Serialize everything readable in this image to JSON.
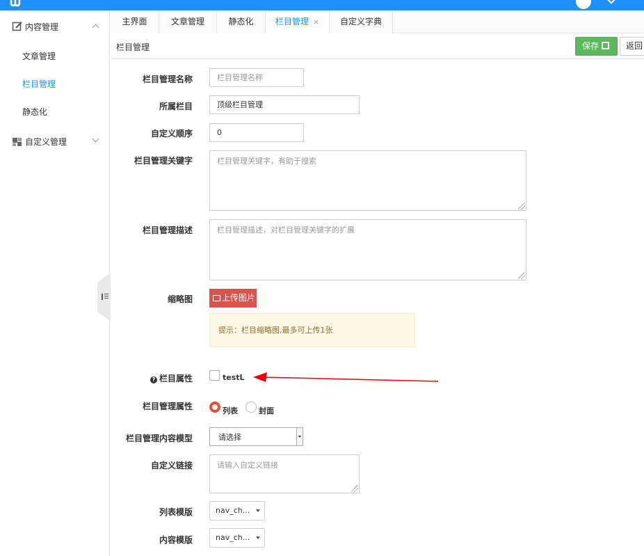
{
  "sidebar": {
    "groups": [
      {
        "label": "内容管理",
        "icon": "edit-icon"
      },
      {
        "label": "自定义管理",
        "icon": "grid-icon"
      }
    ],
    "items": [
      {
        "label": "文章管理"
      },
      {
        "label": "栏目管理"
      },
      {
        "label": "静态化"
      }
    ]
  },
  "tabs": [
    {
      "label": "主界面"
    },
    {
      "label": "文章管理"
    },
    {
      "label": "静态化"
    },
    {
      "label": "栏目管理",
      "close": "×"
    },
    {
      "label": "自定义字典"
    }
  ],
  "toolbar": {
    "title": "栏目管理",
    "save_label": "保存",
    "back_label": "返回"
  },
  "form": {
    "name": {
      "label": "栏目管理名称",
      "placeholder": "栏目管理名称"
    },
    "parent": {
      "label": "所属栏目",
      "value": "顶级栏目管理"
    },
    "order": {
      "label": "自定义顺序",
      "value": "0"
    },
    "keywords": {
      "label": "栏目管理关键字",
      "placeholder": "栏目管理关键字，有助于搜索"
    },
    "description": {
      "label": "栏目管理描述",
      "placeholder": "栏目管理描述，对栏目管理关键字的扩展"
    },
    "thumbnail": {
      "label": "缩略图",
      "button": "上传图片",
      "hint": "提示：栏目缩略图,最多可上传1张"
    },
    "attribute": {
      "label": "栏目属性",
      "option": "testL"
    },
    "type": {
      "label": "栏目管理属性",
      "options": [
        "列表",
        "封面"
      ],
      "selected": "列表"
    },
    "model": {
      "label": "栏目管理内容模型",
      "value": "请选择"
    },
    "link": {
      "label": "自定义链接",
      "placeholder": "请输入自定义链接"
    },
    "list_template": {
      "label": "列表模版",
      "value": "nav_ch..."
    },
    "content_template": {
      "label": "内容模版",
      "value": "nav_ch..."
    }
  },
  "colors": {
    "accent": "#1e90ff",
    "save": "#5cb85c",
    "upload": "#d9534f",
    "annotation": "#e8000b"
  }
}
